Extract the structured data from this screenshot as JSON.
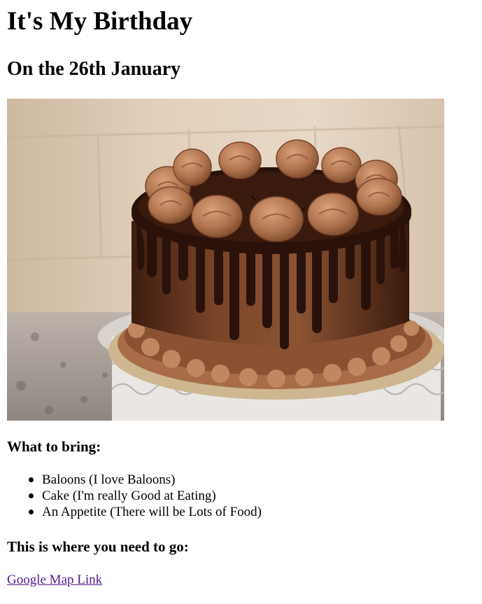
{
  "page": {
    "title": "It's My Birthday",
    "subtitle": "On the 26th January"
  },
  "image": {
    "subject": "chocolate drip cake on white cake stand",
    "colors": {
      "wall": "#d9c6b0",
      "chocolate_dark": "#2a120b",
      "chocolate_mid": "#6e3a22",
      "frosting": "#b0764f",
      "stand": "#e6e2de"
    }
  },
  "bring": {
    "heading": "What to bring:",
    "items": [
      "Baloons (I love Baloons)",
      "Cake (I'm really Good at Eating)",
      "An Appetite (There will be Lots of Food)"
    ]
  },
  "directions": {
    "heading": "This is where you need to go:",
    "link_label": "Google Map Link",
    "link_color": "#551a8b"
  }
}
